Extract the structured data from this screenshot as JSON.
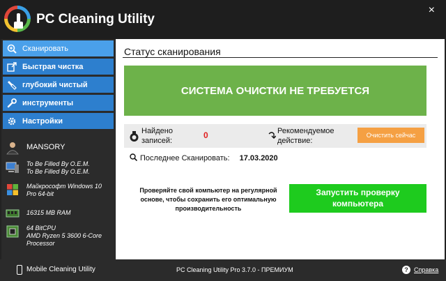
{
  "app": {
    "title": "PC Cleaning Utility",
    "close_symbol": "×",
    "accent_color": "#2d7fce",
    "banner_color": "#6db24a"
  },
  "sidebar": {
    "items": [
      {
        "label": "Сканировать",
        "icon": "scan-icon",
        "active": true
      },
      {
        "label": "Быстрая чистка",
        "icon": "quick-clean-icon",
        "active": false
      },
      {
        "label": "глубокий чистый",
        "icon": "brush-icon",
        "active": false
      },
      {
        "label": "инструменты",
        "icon": "wrench-icon",
        "active": false
      },
      {
        "label": "Настройки",
        "icon": "gear-icon",
        "active": false
      }
    ],
    "system": {
      "user": "MANSORY",
      "model_line1": "To Be Filled By O.E.M.",
      "model_line2": "To Be Filled By O.E.M.",
      "os_line1": "Майкрософт Windows 10",
      "os_line2": "Pro 64-bit",
      "ram": "16315 MB RAM",
      "cpu_line1": "64 BitCPU",
      "cpu_line2": "AMD Ryzen 5 3600 6-Core",
      "cpu_line3": "Processor"
    }
  },
  "main": {
    "section_title": "Статус сканирования",
    "banner_text": "СИСТЕМА ОЧИСТКИ НЕ ТРЕБУЕТСЯ",
    "found_label_1": "Найдено",
    "found_label_2": "записей:",
    "found_count": "0",
    "recommended_1": "Рекомендуемое",
    "recommended_2": "действие:",
    "clean_now_button": "Очистить сейчас",
    "last_scan_label": "Последнее Сканировать:",
    "last_scan_date": "17.03.2020",
    "advice_1": "Проверяйте свой компьютер на регулярной",
    "advice_2": "основе, чтобы сохранить его оптимальную",
    "advice_3": "производительность",
    "start_scan_1": "Запустить проверку",
    "start_scan_2": "компьютера"
  },
  "footer": {
    "mobile_label": "Mobile Cleaning Utility",
    "version": "PC Cleaning Utility Pro 3.7.0 - ПРЕМИУМ",
    "help_label": "Справка"
  }
}
